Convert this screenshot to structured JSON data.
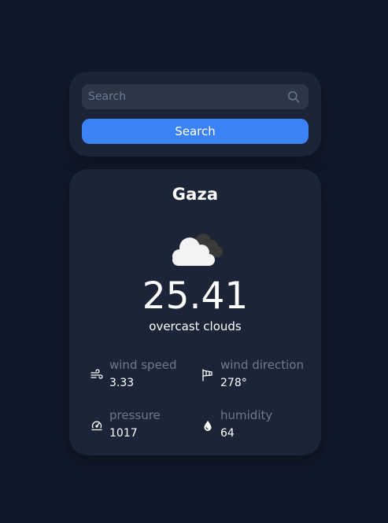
{
  "search": {
    "placeholder": "Search",
    "value": "",
    "button_label": "Search"
  },
  "weather": {
    "city": "Gaza",
    "temperature": "25.41",
    "description": "overcast clouds",
    "icon": "overcast-clouds-icon",
    "stats": {
      "wind_speed": {
        "label": "wind speed",
        "value": "3.33",
        "icon": "wind-icon"
      },
      "wind_direction": {
        "label": "wind direction",
        "value": "278°",
        "icon": "windsock-icon"
      },
      "pressure": {
        "label": "pressure",
        "value": "1017",
        "icon": "pressure-gauge-icon"
      },
      "humidity": {
        "label": "humidity",
        "value": "64",
        "icon": "water-drop-icon"
      }
    }
  },
  "colors": {
    "background": "#111a2c",
    "card": "#1b2537",
    "input": "#2b3649",
    "accent": "#3b82f6",
    "muted_text": "#6b7a8f"
  }
}
